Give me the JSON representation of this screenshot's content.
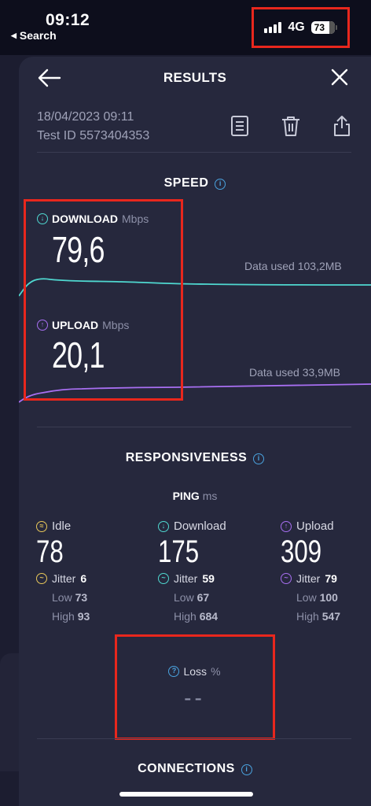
{
  "status": {
    "time": "09:12",
    "back_app": "Search",
    "network": "4G",
    "battery": "73"
  },
  "header": {
    "title": "RESULTS"
  },
  "meta": {
    "datetime": "18/04/2023 09:11",
    "test_id": "Test ID 5573404353"
  },
  "speed": {
    "title": "SPEED",
    "download": {
      "label": "DOWNLOAD",
      "unit": "Mbps",
      "value": "79,6",
      "data_used": "Data used 103,2MB"
    },
    "upload": {
      "label": "UPLOAD",
      "unit": "Mbps",
      "value": "20,1",
      "data_used": "Data used 33,9MB"
    }
  },
  "responsiveness": {
    "title": "RESPONSIVENESS",
    "ping_label": "PING",
    "ping_unit": "ms",
    "columns": [
      {
        "label": "Idle",
        "value": "78",
        "jitter_label": "Jitter",
        "jitter": "6",
        "low_label": "Low",
        "low": "73",
        "high_label": "High",
        "high": "93"
      },
      {
        "label": "Download",
        "value": "175",
        "jitter_label": "Jitter",
        "jitter": "59",
        "low_label": "Low",
        "low": "67",
        "high_label": "High",
        "high": "684"
      },
      {
        "label": "Upload",
        "value": "309",
        "jitter_label": "Jitter",
        "jitter": "79",
        "low_label": "Low",
        "low": "100",
        "high_label": "High",
        "high": "547"
      }
    ],
    "loss": {
      "label": "Loss",
      "unit": "%",
      "value": "--"
    }
  },
  "connections": {
    "title": "CONNECTIONS"
  },
  "colors": {
    "download": "#4fd8d0",
    "upload": "#a86ff2",
    "idle": "#e9c85a",
    "accent": "#4aa3df",
    "highlight": "#e8271d"
  }
}
